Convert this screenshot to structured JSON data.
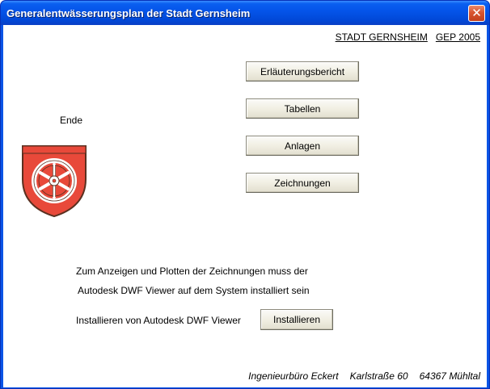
{
  "window": {
    "title": "Generalentwässerungsplan der Stadt Gernsheim",
    "close_symbol": "✕"
  },
  "header": {
    "city": "STADT GERNSHEIM",
    "plan": "GEP 2005"
  },
  "ende_label": "Ende",
  "crest": {
    "icon": "coat-of-arms-wheel-icon",
    "colors": {
      "shield": "#e8493a",
      "wheel": "#ffffff",
      "outline": "#5a3020"
    }
  },
  "buttons": {
    "erlaeuterungsbericht": "Erläuterungsbericht",
    "tabellen": "Tabellen",
    "anlagen": "Anlagen",
    "zeichnungen": "Zeichnungen"
  },
  "info": {
    "line1": "Zum Anzeigen und Plotten der Zeichnungen muss der",
    "line2": "Autodesk DWF Viewer auf dem System installiert sein"
  },
  "install": {
    "label": "Installieren von Autodesk DWF Viewer",
    "button": "Installieren"
  },
  "footer": {
    "company": "Ingenieurbüro Eckert",
    "street": "Karlstraße 60",
    "city": "64367 Mühltal"
  },
  "colors": {
    "titlebar": "#0453e8",
    "button_face": "#f1efe3",
    "close": "#d9552f"
  }
}
